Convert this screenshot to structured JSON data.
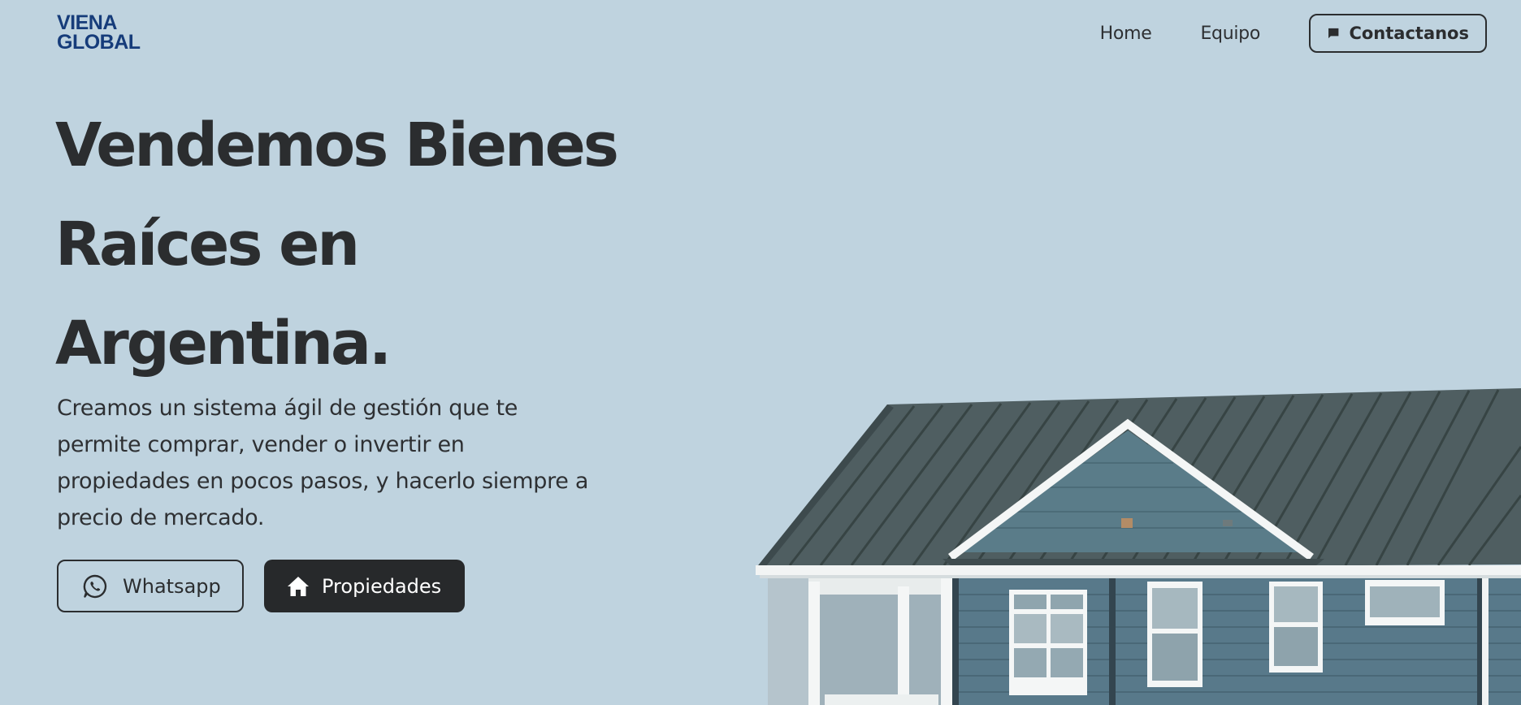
{
  "header": {
    "logo_line1": "VIENA",
    "logo_line2": "GLOBAL",
    "nav": [
      "Home",
      "Equipo"
    ],
    "contact_label": "Contactanos"
  },
  "hero": {
    "title_lines": [
      "Vendemos Bienes",
      "Raíces en",
      "Argentina."
    ],
    "description_lines": [
      "Creamos un sistema ágil de gestión que te",
      "permite comprar, vender o invertir en",
      "propiedades en pocos pasos, y hacerlo siempre a",
      "precio de mercado."
    ],
    "whatsapp_label": "Whatsapp",
    "properties_label": "Propiedades"
  },
  "colors": {
    "background": "#bfd3df",
    "logo": "#163c7a",
    "text": "#2b2d2f",
    "dark_button": "#27292b"
  },
  "icons": {
    "contact": "chat-bubble-icon",
    "whatsapp": "whatsapp-icon",
    "properties": "home-icon"
  }
}
